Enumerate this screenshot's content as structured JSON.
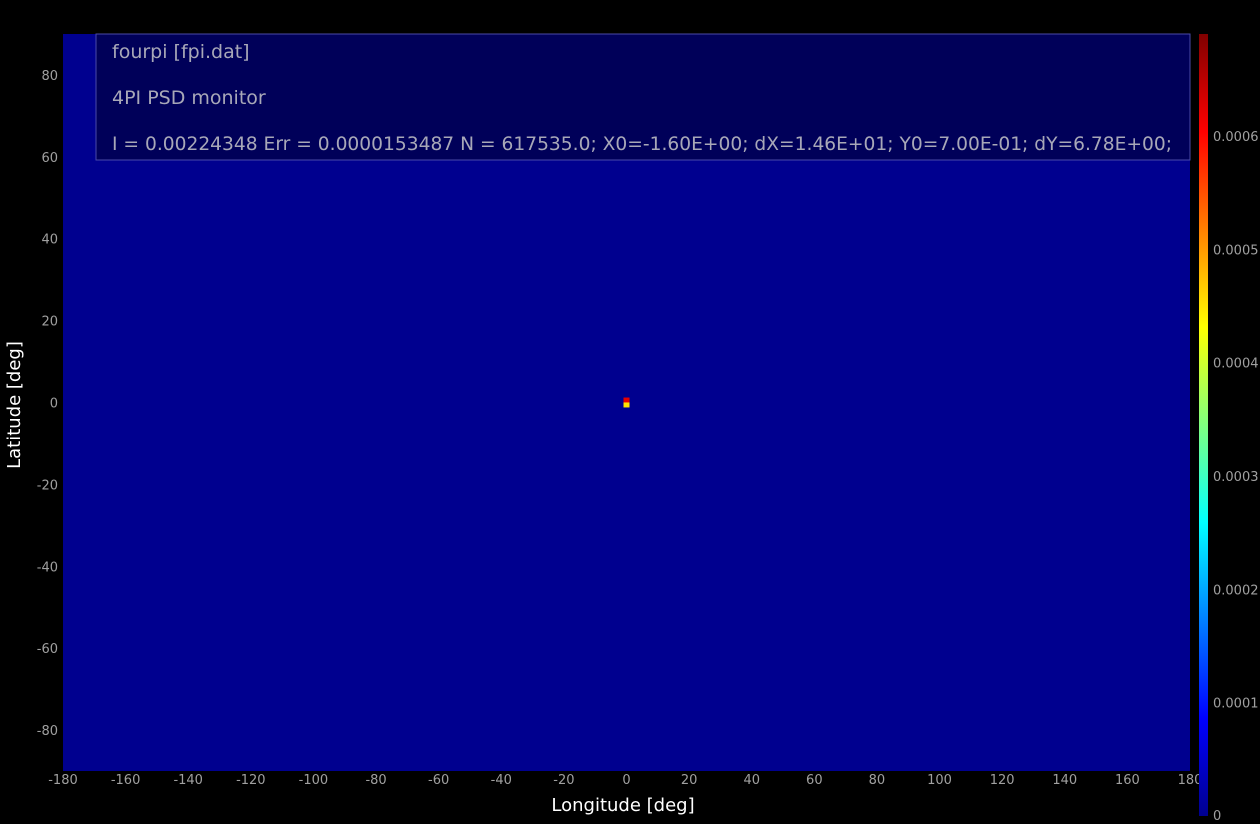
{
  "chart_data": {
    "type": "heatmap",
    "title": "fourpi [fpi.dat]",
    "subtitle": "4PI PSD monitor",
    "stats": "I = 0.00224348 Err = 0.0000153487 N = 617535.0; X0=-1.60E+00; dX=1.46E+01; Y0=7.00E-01; dY=6.78E+00;",
    "xlabel": "Longitude [deg]",
    "ylabel": "Latitude [deg]",
    "xlim": [
      -180,
      180
    ],
    "ylim": [
      -90,
      90
    ],
    "xticks": [
      -180,
      -160,
      -140,
      -120,
      -100,
      -80,
      -60,
      -40,
      -20,
      0,
      20,
      40,
      60,
      80,
      100,
      120,
      140,
      160,
      180
    ],
    "yticks": [
      -80,
      -60,
      -40,
      -20,
      0,
      20,
      40,
      60,
      80
    ],
    "xtick_labels": [
      "-180",
      "-160",
      "-140",
      "-120",
      "-100",
      "-80",
      "-60",
      "-40",
      "-20",
      "0",
      "20",
      "40",
      "60",
      "80",
      "100",
      "120",
      "140",
      "160",
      "180"
    ],
    "ytick_labels": [
      "-80",
      "-60",
      "-40",
      "-20",
      "0",
      "20",
      "40",
      "60",
      "80"
    ],
    "background_value": 0,
    "hot_cells": [
      {
        "lon": 0,
        "lat": 0.6,
        "value": 0.00062
      },
      {
        "lon": 0,
        "lat": -0.6,
        "value": 0.00045
      }
    ],
    "colorbar": {
      "min": 0,
      "max": 0.00069,
      "ticks": [
        0,
        0.0001,
        0.0002,
        0.0003,
        0.0004,
        0.0005,
        0.0006
      ],
      "tick_labels": [
        "0",
        "0.0001",
        "0.0002",
        "0.0003",
        "0.0004",
        "0.0005",
        "0.0006"
      ],
      "colormap": "jet"
    },
    "colors": {
      "plot_background": "#00008f",
      "info_box_fill": "#000050",
      "info_box_border": "#4a4aa8",
      "page_background": "#000000"
    }
  }
}
